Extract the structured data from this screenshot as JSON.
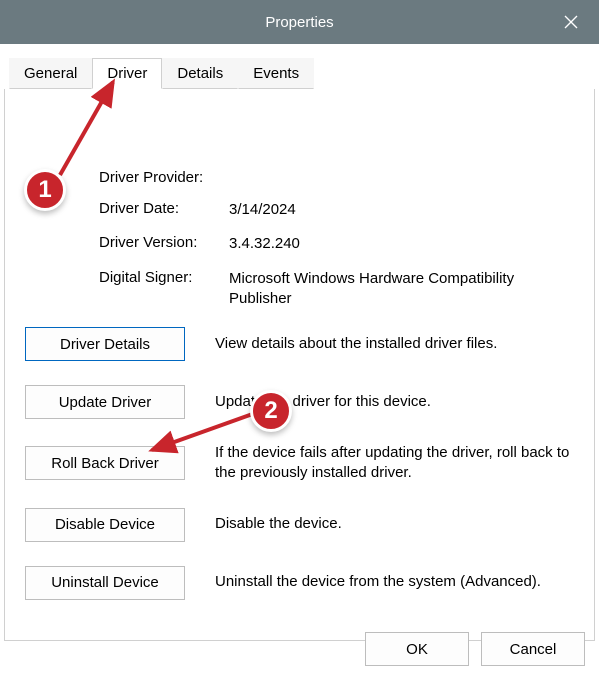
{
  "window": {
    "title": "Properties"
  },
  "tabs": {
    "general": "General",
    "driver": "Driver",
    "details": "Details",
    "events": "Events"
  },
  "info": {
    "provider_label": "Driver Provider:",
    "provider_value": "",
    "date_label": "Driver Date:",
    "date_value": "3/14/2024",
    "version_label": "Driver Version:",
    "version_value": "3.4.32.240",
    "signer_label": "Digital Signer:",
    "signer_value": "Microsoft Windows Hardware Compatibility Publisher"
  },
  "actions": {
    "details_btn": "Driver Details",
    "details_desc": "View details about the installed driver files.",
    "update_btn": "Update Driver",
    "update_desc": "Update the driver for this device.",
    "rollback_btn": "Roll Back Driver",
    "rollback_desc": "If the device fails after updating the driver, roll back to the previously installed driver.",
    "disable_btn": "Disable Device",
    "disable_desc": "Disable the device.",
    "uninstall_btn": "Uninstall Device",
    "uninstall_desc": "Uninstall the device from the system (Advanced)."
  },
  "footer": {
    "ok": "OK",
    "cancel": "Cancel"
  },
  "annotations": {
    "step1": "1",
    "step2": "2"
  }
}
